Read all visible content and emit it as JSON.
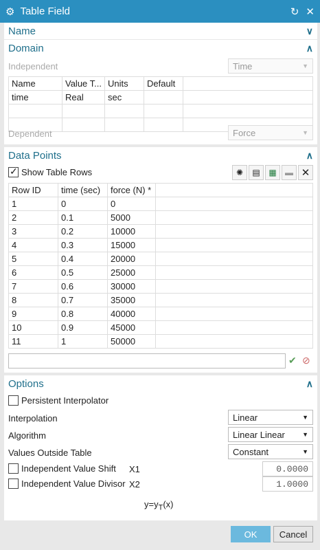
{
  "window": {
    "title": "Table Field"
  },
  "sections": {
    "name": "Name",
    "domain": "Domain",
    "data_points": "Data Points",
    "options": "Options"
  },
  "domain": {
    "independent_label": "Independent",
    "independent_value": "Time",
    "dependent_label": "Dependent",
    "dependent_value": "Force",
    "columns": [
      "Name",
      "Value T...",
      "Units",
      "Default"
    ],
    "rows": [
      [
        "time",
        "Real",
        "sec",
        ""
      ]
    ]
  },
  "data_points": {
    "show_rows_label": "Show Table Rows",
    "columns": [
      "Row ID",
      "time (sec)",
      "force (N) *"
    ],
    "rows": [
      [
        "1",
        "0",
        "0"
      ],
      [
        "2",
        "0.1",
        "5000"
      ],
      [
        "3",
        "0.2",
        "10000"
      ],
      [
        "4",
        "0.3",
        "15000"
      ],
      [
        "5",
        "0.4",
        "20000"
      ],
      [
        "6",
        "0.5",
        "25000"
      ],
      [
        "7",
        "0.6",
        "30000"
      ],
      [
        "8",
        "0.7",
        "35000"
      ],
      [
        "9",
        "0.8",
        "40000"
      ],
      [
        "10",
        "0.9",
        "45000"
      ],
      [
        "11",
        "1",
        "50000"
      ]
    ]
  },
  "options": {
    "persistent_label": "Persistent Interpolator",
    "interpolation_label": "Interpolation",
    "interpolation_value": "Linear",
    "algorithm_label": "Algorithm",
    "algorithm_value": "Linear Linear",
    "outside_label": "Values Outside Table",
    "outside_value": "Constant",
    "shift_label": "Independent Value Shift",
    "shift_var": "X1",
    "shift_value": "0.0000",
    "divisor_label": "Independent Value Divisor",
    "divisor_var": "X2",
    "divisor_value": "1.0000",
    "formula_main": "y=y",
    "formula_sub": "T",
    "formula_tail": "(x)"
  },
  "buttons": {
    "ok": "OK",
    "cancel": "Cancel"
  }
}
